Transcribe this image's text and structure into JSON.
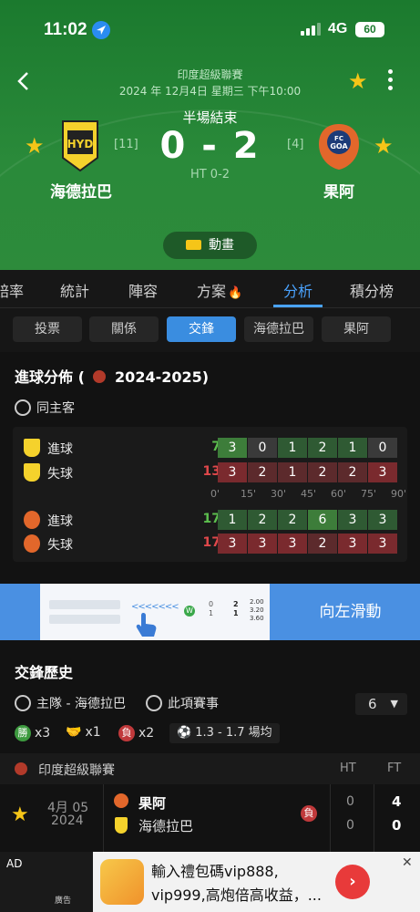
{
  "status_bar": {
    "time": "11:02",
    "network": "4G",
    "battery": "60"
  },
  "match": {
    "league": "印度超級聯賽",
    "datetime": "2024 年 12月4日 星期三 下午10:00",
    "status": "半場結束",
    "score": "0 - 2",
    "halftime": "HT 0-2",
    "home": {
      "name": "海德拉巴",
      "rank": "[11]",
      "crest_text": "HYD"
    },
    "away": {
      "name": "果阿",
      "rank": "[4]",
      "crest_text": "GOA"
    },
    "animation_label": "動畫"
  },
  "tabs": [
    "賠率",
    "統計",
    "陣容",
    "方案",
    "分析",
    "積分榜"
  ],
  "active_tab": "分析",
  "sub_tabs": [
    "投票",
    "關係",
    "交鋒",
    "海德拉巴",
    "果阿"
  ],
  "active_sub_tab": "交鋒",
  "goal_distribution": {
    "title": "進球分佈 (",
    "season": "2024-2025)",
    "option": "同主客",
    "minute_marks": [
      "0'",
      "15'",
      "30'",
      "45'",
      "60'",
      "75'",
      "90'"
    ],
    "rows": [
      {
        "team": "home",
        "label": "進球",
        "total": "7",
        "values": [
          "3",
          "0",
          "1",
          "2",
          "1",
          "0"
        ]
      },
      {
        "team": "home",
        "label": "失球",
        "total": "13",
        "values": [
          "3",
          "2",
          "1",
          "2",
          "2",
          "3"
        ]
      },
      {
        "team": "away",
        "label": "進球",
        "total": "17",
        "values": [
          "1",
          "2",
          "2",
          "6",
          "3",
          "3"
        ]
      },
      {
        "team": "away",
        "label": "失球",
        "total": "17",
        "values": [
          "3",
          "3",
          "3",
          "2",
          "3",
          "3"
        ]
      }
    ]
  },
  "swipe_banner": {
    "label": "向左滑動",
    "mini_values": [
      "2.00",
      "3.20",
      "3.60",
      "0",
      "1",
      "2",
      "1",
      "1"
    ]
  },
  "h2h": {
    "title": "交鋒歷史",
    "filter_home": "主隊 - 海德拉巴",
    "filter_league": "此項賽事",
    "count": "6",
    "win_badge": "勝",
    "wins": "x3",
    "draws": "x1",
    "loss_badge": "負",
    "losses": "x2",
    "avg": "1.3 - 1.7 場均",
    "league_name": "印度超級聯賽",
    "col_ht": "HT",
    "col_ft": "FT",
    "match": {
      "date": "4月 05",
      "year": "2024",
      "team1": "果阿",
      "team2": "海德拉巴",
      "result": "負",
      "ht1": "0",
      "ht2": "0",
      "ft1": "4",
      "ft2": "0"
    }
  },
  "ad": {
    "tag": "AD",
    "sub": "廣告",
    "line1": "輸入禮包碼vip888,",
    "line2": "vip999,高炮倍高收益，..."
  },
  "colors": {
    "header_green": "#2a8a3a",
    "accent_blue": "#4aa3ff",
    "star": "#f5c518",
    "goal_green": "#3d7d3a",
    "concede_red": "#7a2a2e"
  }
}
